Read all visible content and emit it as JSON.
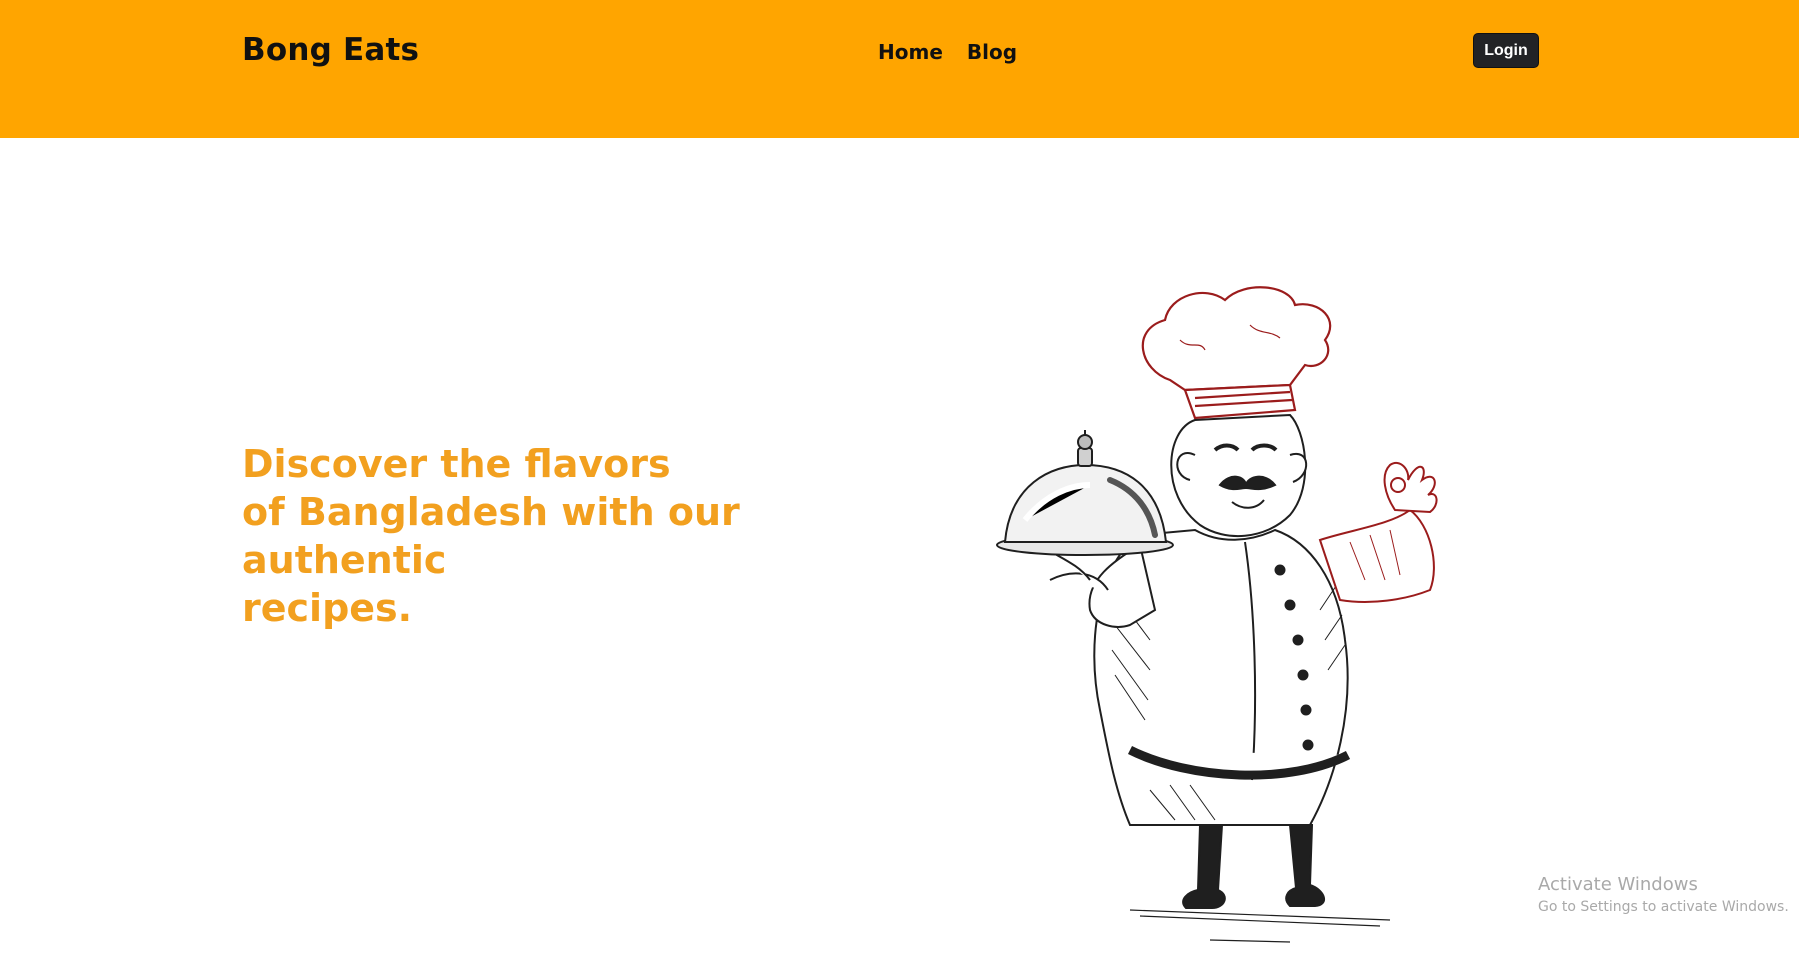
{
  "header": {
    "brand": "Bong Eats",
    "nav": [
      "Home",
      "Blog"
    ],
    "login_label": "Login"
  },
  "hero": {
    "lines": [
      "Discover the flavors",
      "of Bangladesh with our authentic",
      "recipes."
    ]
  },
  "illustration": {
    "subject": "chef-holding-cloche",
    "colors": {
      "hat_and_hand_line": "#9b1c1c",
      "body_line": "#1f1f1f",
      "fill": "#ffffff"
    }
  },
  "watermark": {
    "title": "Activate Windows",
    "subtitle": "Go to Settings to activate Windows."
  },
  "colors": {
    "navbar": "#ffa500",
    "hero_text": "#f2a01f",
    "login_bg": "#222326"
  }
}
